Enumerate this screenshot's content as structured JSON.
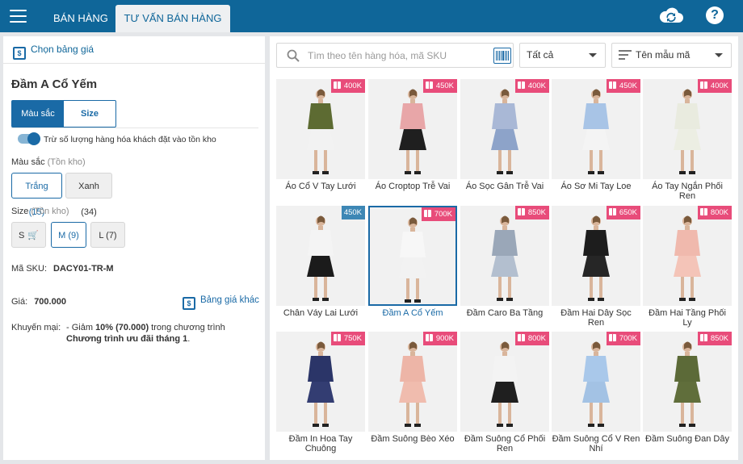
{
  "colors": {
    "header": "#0f6699",
    "accent": "#1a6aa6",
    "badge_pink": "#e84c7a",
    "badge_blue": "#3d87b5"
  },
  "header": {
    "menu_icon": "hamburger-menu-icon",
    "tabs": [
      {
        "label": "BÁN HÀNG"
      },
      {
        "label": "TƯ VẤN BÁN HÀNG",
        "active": true
      }
    ],
    "sync_icon": "cloud-sync-icon",
    "help_icon": "help-icon",
    "help_glyph": "?"
  },
  "left": {
    "pricebook_label": "Chọn bảng giá",
    "product_name": "Đầm A Cổ Yếm",
    "segment": {
      "color_label": "Màu sắc",
      "size_label": "Size"
    },
    "toggle_label": "Trừ số lượng hàng hóa khách đặt vào tồn kho",
    "color_section": {
      "label": "Màu sắc",
      "hint": "(Tồn kho)",
      "options": [
        {
          "label": "Trắng (15)",
          "selected": true
        },
        {
          "label": "Xanh (34)",
          "selected": false
        }
      ]
    },
    "size_section": {
      "label": "Size",
      "hint": "(Tồn kho)",
      "options": [
        {
          "label": "S",
          "out_of_stock": true,
          "selected": false
        },
        {
          "label": "M (9)",
          "selected": true
        },
        {
          "label": "L (7)",
          "selected": false
        }
      ]
    },
    "sku": {
      "label": "Mã SKU:",
      "value": "DACY01-TR-M"
    },
    "price": {
      "label": "Giá:",
      "value": "700.000"
    },
    "other_price_label": "Bảng giá khác",
    "promo": {
      "label": "Khuyến mại:",
      "prefix": "- Giảm",
      "discount": "10% (70.000)",
      "middle": "trong chương trình",
      "program": "Chương trình ưu đãi tháng 1",
      "suffix": "."
    }
  },
  "right": {
    "search": {
      "placeholder": "Tìm theo tên hàng hóa, mã SKU",
      "value": ""
    },
    "filter_value": "Tất cả",
    "sort_value": "Tên mẫu mã",
    "products": [
      {
        "name": "Áo Cổ V Tay Lưới",
        "price": "400K",
        "gift": true,
        "top": "#5d6b32",
        "bottom": "#f2f2f2"
      },
      {
        "name": "Áo Croptop Trễ Vai",
        "price": "450K",
        "gift": true,
        "top": "#e8a6a8",
        "bottom": "#1f1f1f"
      },
      {
        "name": "Áo Sọc Gân Trễ Vai",
        "price": "400K",
        "gift": true,
        "top": "#a9b8d6",
        "bottom": "#8da3c9"
      },
      {
        "name": "Áo Sơ Mi Tay Loe",
        "price": "450K",
        "gift": true,
        "top": "#a8c4e6",
        "bottom": "#f4f4f4"
      },
      {
        "name": "Áo Tay Ngắn Phối Ren",
        "price": "400K",
        "gift": true,
        "top": "#e9ebdf",
        "bottom": "#eceee3"
      },
      {
        "name": "Chân Váy Lai Lưới",
        "price": "450K",
        "gift": false,
        "top": "#f4f4f4",
        "bottom": "#1b1b1b"
      },
      {
        "name": "Đầm A Cổ Yếm",
        "price": "700K",
        "gift": true,
        "top": "#f7f7f7",
        "bottom": "#f2f2f2",
        "active": true
      },
      {
        "name": "Đầm Caro Ba Tầng",
        "price": "850K",
        "gift": true,
        "top": "#9aa7b8",
        "bottom": "#b3bfcf"
      },
      {
        "name": "Đầm Hai Dây Sọc Ren",
        "price": "650K",
        "gift": true,
        "top": "#1d1d1d",
        "bottom": "#262626"
      },
      {
        "name": "Đầm Hai Tầng Phối Ly",
        "price": "800K",
        "gift": true,
        "top": "#f0b9ad",
        "bottom": "#f4c4b8"
      },
      {
        "name": "Đầm In Hoa Tay Chuông",
        "price": "750K",
        "gift": true,
        "top": "#2b3568",
        "bottom": "#333d72"
      },
      {
        "name": "Đầm Suông Bèo Xéo",
        "price": "900K",
        "gift": true,
        "top": "#edb5a7",
        "bottom": "#f0bcae"
      },
      {
        "name": "Đầm Suông Cổ Phối Ren",
        "price": "800K",
        "gift": true,
        "top": "#f3f3f3",
        "bottom": "#1f1f1f"
      },
      {
        "name": "Đầm Suông Cổ V Ren Nhí",
        "price": "700K",
        "gift": true,
        "top": "#a9c8ea",
        "bottom": "#a3c2e4"
      },
      {
        "name": "Đầm Suông Đan Dây",
        "price": "850K",
        "gift": true,
        "top": "#5c6a38",
        "bottom": "#606e3b"
      }
    ]
  }
}
